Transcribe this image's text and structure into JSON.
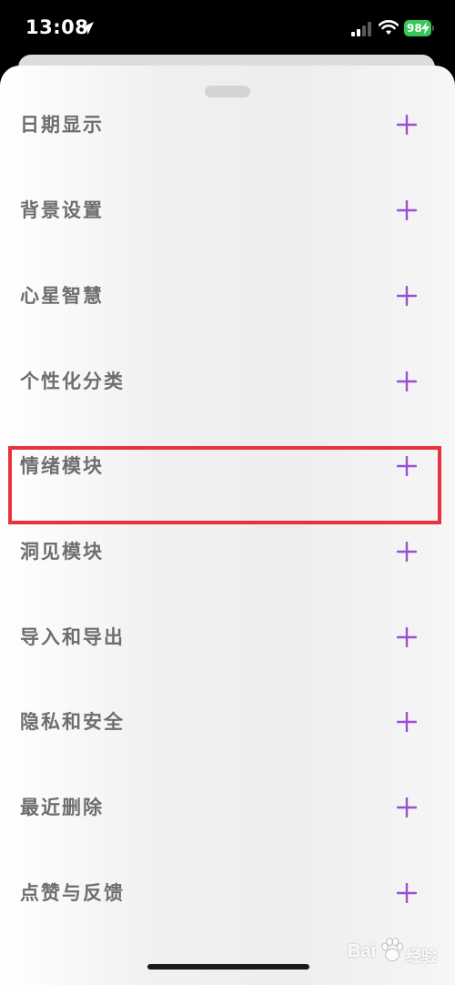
{
  "status_bar": {
    "time": "13:08",
    "battery_level": "98",
    "battery_color": "#35c759"
  },
  "menu": {
    "plus_color": "#9b4fd1",
    "items": [
      {
        "label": "日期显示",
        "icon": "plus-icon"
      },
      {
        "label": "背景设置",
        "icon": "plus-icon"
      },
      {
        "label": "心星智慧",
        "icon": "plus-icon"
      },
      {
        "label": "个性化分类",
        "icon": "plus-icon"
      },
      {
        "label": "情绪模块",
        "icon": "plus-icon"
      },
      {
        "label": "洞见模块",
        "icon": "plus-icon",
        "highlighted": true
      },
      {
        "label": "导入和导出",
        "icon": "plus-icon"
      },
      {
        "label": "隐私和安全",
        "icon": "plus-icon"
      },
      {
        "label": "最近删除",
        "icon": "plus-icon"
      },
      {
        "label": "点赞与反馈",
        "icon": "plus-icon"
      }
    ]
  },
  "annotation": {
    "highlight_color": "#e8323f"
  },
  "watermark": {
    "brand": "Bai",
    "brand_suffix": "经验",
    "logo": "paw-icon"
  }
}
